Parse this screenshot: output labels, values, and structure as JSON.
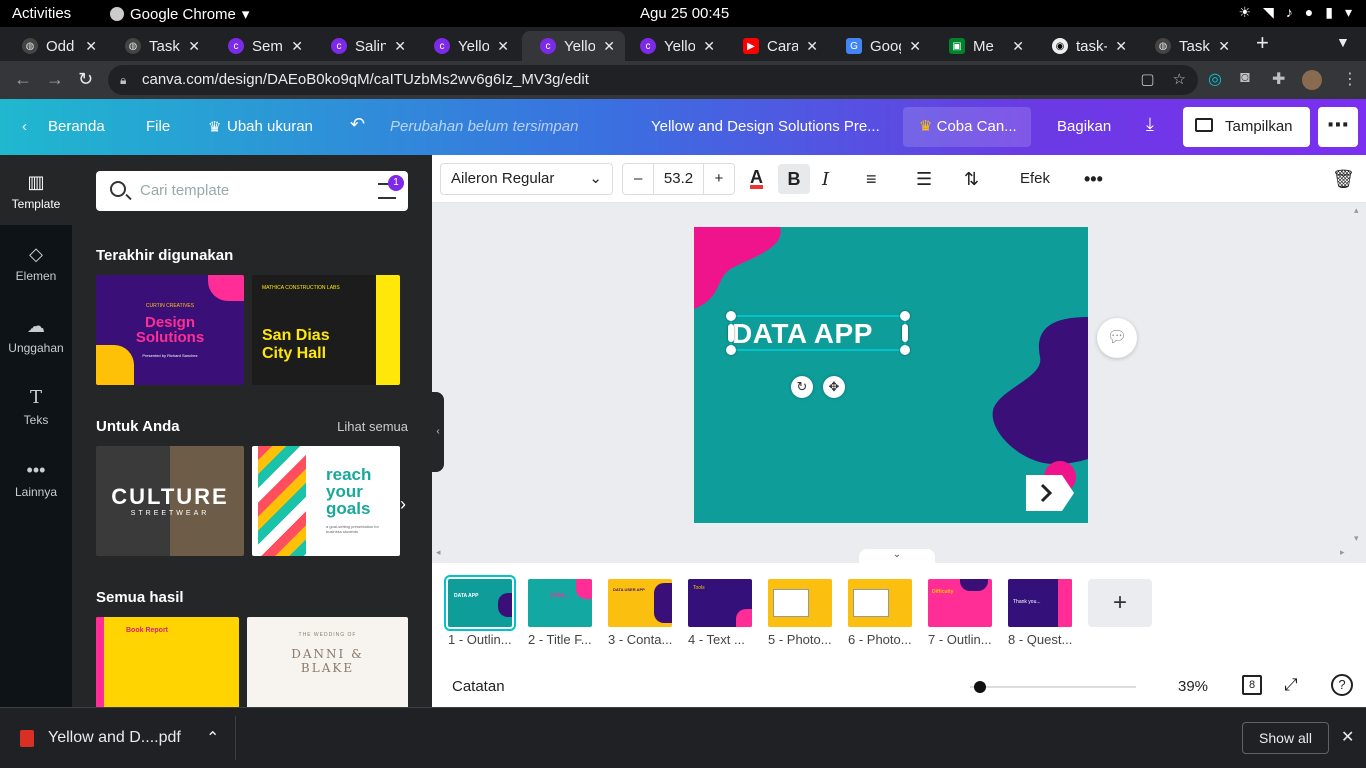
{
  "system": {
    "activities": "Activities",
    "app_name": "Google Chrome",
    "clock": "Agu 25  00:45"
  },
  "tabs": [
    {
      "title": "Odd E",
      "icon": "globe-icon"
    },
    {
      "title": "Task V",
      "icon": "globe-icon"
    },
    {
      "title": "Semu",
      "icon": "canva-icon"
    },
    {
      "title": "Salina",
      "icon": "canva-icon"
    },
    {
      "title": "Yellov",
      "icon": "canva-icon"
    },
    {
      "title": "Yellov",
      "icon": "canva-icon",
      "active": true
    },
    {
      "title": "Yellov",
      "icon": "canva-icon"
    },
    {
      "title": "Cara I",
      "icon": "youtube-icon"
    },
    {
      "title": "Goog",
      "icon": "translate-icon"
    },
    {
      "title": "Me",
      "icon": "meet-icon"
    },
    {
      "title": "task-v",
      "icon": "github-icon"
    },
    {
      "title": "Task V",
      "icon": "globe-icon"
    }
  ],
  "address": {
    "url": "canva.com/design/DAEoB0ko9qM/caITUzbMs2wv6g6Iz_MV3g/edit"
  },
  "header": {
    "back": "Beranda",
    "file": "File",
    "resize": "Ubah ukuran",
    "unsaved": "Perubahan belum tersimpan",
    "title": "Yellow and Design Solutions Pre...",
    "try_pro": "Coba Can...",
    "share": "Bagikan",
    "present": "Tampilkan"
  },
  "rail": [
    {
      "label": "Template",
      "icon": "template-icon",
      "active": true
    },
    {
      "label": "Elemen",
      "icon": "elements-icon"
    },
    {
      "label": "Unggahan",
      "icon": "upload-icon"
    },
    {
      "label": "Teks",
      "icon": "text-icon"
    },
    {
      "label": "Lainnya",
      "icon": "more-icon"
    }
  ],
  "panel": {
    "search_placeholder": "Cari template",
    "filter_badge": "1",
    "recent_heading": "Terakhir digunakan",
    "foryou_heading": "Untuk Anda",
    "see_all": "Lihat semua",
    "all_heading": "Semua hasil",
    "thumbs": {
      "t1_small": "CURTIN CREATIVES",
      "t1_big": "Design Solutions",
      "t1_sub": "Presented by Richard Sanchez",
      "t2_small": "MATHICA CONSTRUCTION LABS",
      "t2_big": "San Dias City Hall",
      "t3_big": "CULTURE",
      "t3_sub": "STREETWEAR",
      "t4_big": "reach your goals",
      "t4_sub": "a goal-setting presentation for business students",
      "t5_big": "Book Report",
      "t6_big": "DANNI & BLAKE",
      "t6_small": "THE WEDDING OF"
    }
  },
  "toolbar": {
    "font": "Aileron Regular",
    "minus": "–",
    "size": "53.2",
    "plus": "+",
    "text_color_letter": "A",
    "bold": "B",
    "italic": "I",
    "effects": "Efek"
  },
  "slide": {
    "text": "DATA APP",
    "bg_color": "#0f9d9a",
    "accent_pink": "#f0148c",
    "accent_purple": "#3a1078"
  },
  "pages": [
    {
      "label": "1 - Outlin...",
      "bg": "#0f9d9a",
      "text": "DATA APP"
    },
    {
      "label": "2 - Title F...",
      "bg": "#14a8a3",
      "text": "CURA..."
    },
    {
      "label": "3 - Conta...",
      "bg": "#fbbf10",
      "text": "DATA USER APP"
    },
    {
      "label": "4 - Text ...",
      "bg": "#34107a",
      "text": "Tools"
    },
    {
      "label": "5 - Photo...",
      "bg": "#fbbf10",
      "text": ""
    },
    {
      "label": "6 - Photo...",
      "bg": "#fbbf10",
      "text": ""
    },
    {
      "label": "7 - Outlin...",
      "bg": "#ff2d95",
      "text": "Difficulty"
    },
    {
      "label": "8 - Quest...",
      "bg": "#34107a",
      "text": "Thank you..."
    }
  ],
  "status": {
    "notes": "Catatan",
    "zoom": "39%",
    "page_count": "8"
  },
  "download": {
    "file": "Yellow and D....pdf",
    "show_all": "Show all"
  }
}
